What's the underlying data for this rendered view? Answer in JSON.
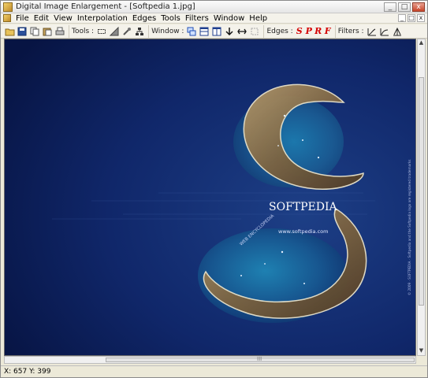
{
  "window": {
    "title": "Digital Image Enlargement - [Softpedia 1.jpg]",
    "controls": [
      "_",
      "□",
      "x"
    ]
  },
  "menu": {
    "items": [
      "File",
      "Edit",
      "View",
      "Interpolation",
      "Edges",
      "Tools",
      "Filters",
      "Window",
      "Help"
    ],
    "mdi_controls": [
      "_",
      "□",
      "x"
    ]
  },
  "toolbar": {
    "tools_label": "Tools :",
    "window_label": "Window :",
    "edges_label": "Edges :",
    "filters_label": "Filters :",
    "edge_letters": [
      "S",
      "P",
      "R",
      "F"
    ]
  },
  "image": {
    "brand_text": "SOFTPEDIA",
    "url_text": "www.softpedia.com",
    "tagline": "WEB ENCYCLOPEDIA",
    "side_text": "© 2009 · SOFTPEDIA · Softpedia and the Softpedia logo are registered trademarks"
  },
  "scroll": {
    "grip": "III"
  },
  "status": {
    "coords": "X: 657  Y: 399"
  },
  "colors": {
    "background_deep": "#0b1c4e",
    "edge_letter": "#d40000"
  }
}
